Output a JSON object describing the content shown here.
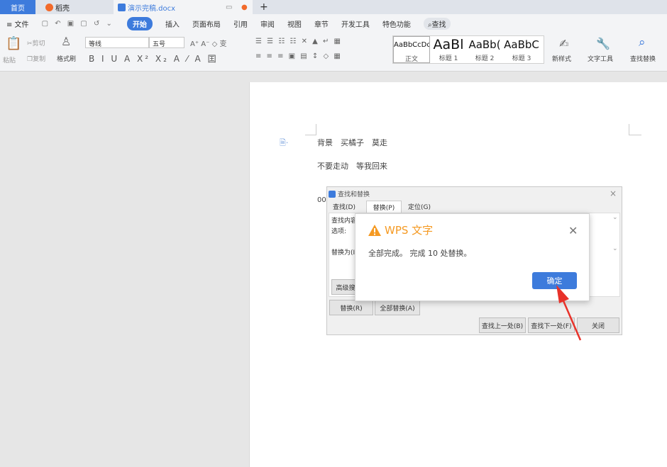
{
  "tabs": {
    "home": "首页",
    "daoke": "稻壳",
    "doc": "演示完稿.docx",
    "add": "+"
  },
  "menu": {
    "file": "≡ 文件",
    "start": "开始",
    "insert": "插入",
    "layout": "页面布局",
    "ref": "引用",
    "review": "审阅",
    "view": "视图",
    "chapter": "章节",
    "dev": "开发工具",
    "special": "特色功能",
    "search": "查找"
  },
  "ribbon": {
    "paste": "粘贴",
    "cut": "剪切",
    "copy": "复制",
    "painter": "格式刷",
    "font": "等线",
    "size": "五号",
    "styles": [
      {
        "sample": "AaBbCcDd",
        "name": "正文"
      },
      {
        "sample": "AaBl",
        "name": "标题 1"
      },
      {
        "sample": "AaBb(",
        "name": "标题 2"
      },
      {
        "sample": "AaBbC",
        "name": "标题 3"
      }
    ],
    "newstyle": "新样式",
    "texttool": "文字工具",
    "findreplace": "查找替换"
  },
  "doc": {
    "line1": "背景　买橘子　莫走",
    "line2": "不要走动　等我回来",
    "line3": "00"
  },
  "find_replace": {
    "title": "查找和替换",
    "tab_find": "查找(D)",
    "tab_replace": "替换(P)",
    "tab_goto": "定位(G)",
    "find_label": "查找内容",
    "options_label": "选项:",
    "replace_label": "替换为(I)",
    "advanced": "高级搜",
    "replace_btn": "替换(R)",
    "replace_all_btn": "全部替换(A)",
    "find_prev": "查找上一处(B)",
    "find_next": "查找下一处(F)",
    "close": "关闭"
  },
  "message": {
    "title": "WPS 文字",
    "body": "全部完成。 完成 10 处替换。",
    "ok": "确定"
  },
  "colors": {
    "accent": "#3d7bdc",
    "warn": "#f59a23",
    "arrow": "#e8322a"
  }
}
